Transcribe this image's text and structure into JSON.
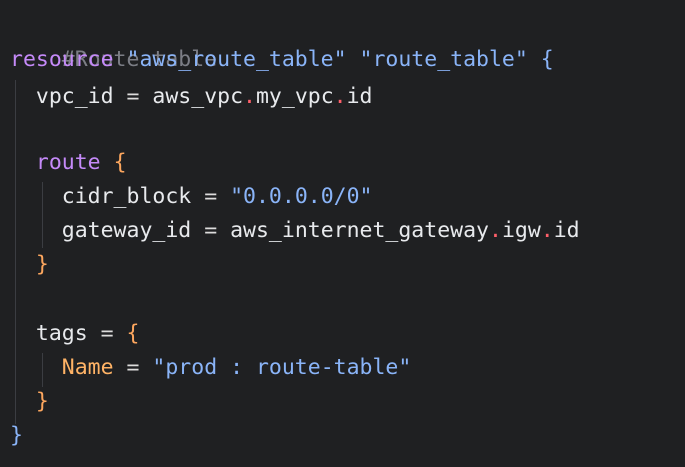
{
  "editor": {
    "comment": "#Route table",
    "resource_keyword": "resource",
    "resource_type": "\"aws_route_table\"",
    "resource_name": "\"route_table\"",
    "open_brace": "{",
    "close_brace": "}",
    "vpc_id_key": "vpc_id",
    "equals": "=",
    "vpc_ref_a": "aws_vpc",
    "vpc_ref_b": "my_vpc",
    "vpc_ref_c": "id",
    "dot": ".",
    "route_keyword": "route",
    "cidr_key": "cidr_block",
    "cidr_value": "\"0.0.0.0/0\"",
    "gateway_key": "gateway_id",
    "gw_ref_a": "aws_internet_gateway",
    "gw_ref_b": "igw",
    "gw_ref_c": "id",
    "tags_key": "tags",
    "name_key": "Name",
    "name_value": "\"prod : route-table\""
  },
  "colors": {
    "background": "#1f2022",
    "comment": "#7c7e86",
    "keyword": "#c58af9",
    "string": "#8ab4f8",
    "dot": "#ff5f6a",
    "attr": "#ffb366"
  }
}
